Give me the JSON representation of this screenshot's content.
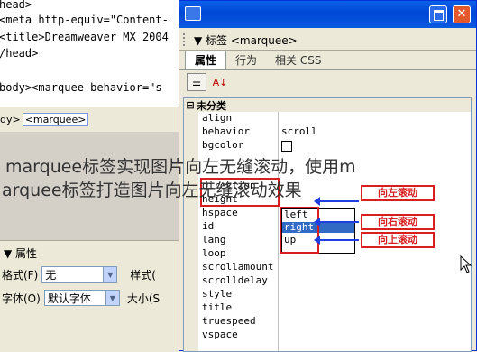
{
  "code": {
    "lines": [
      "head>",
      "<meta http-equiv=\"Content-",
      "<title>Dreamweaver MX 2004",
      "/head>",
      "",
      "body><marquee behavior=\"s"
    ]
  },
  "tag_selector": {
    "body_tag": "dy>",
    "marquee_tag": "<marquee>"
  },
  "left_props": {
    "title": "▼ 属性",
    "format_label": "格式(F)",
    "format_value": "无",
    "style_label": "样式(",
    "font_label": "字体(O)",
    "font_value": "默认字体",
    "size_label": "大小(S"
  },
  "panel": {
    "header": "▼ 标签 <marquee>",
    "tabs": [
      "属性",
      "行为",
      "相关 CSS"
    ],
    "active_tab": 0,
    "toolbar": {
      "list_icon": "list-icon",
      "sort_icon": "sort-az-icon"
    },
    "category": "未分类",
    "properties": [
      {
        "name": "align",
        "value": ""
      },
      {
        "name": "behavior",
        "value": "scroll"
      },
      {
        "name": "bgcolor",
        "value": ""
      },
      {
        "name": "direction",
        "value": ""
      },
      {
        "name": "height",
        "value": ""
      },
      {
        "name": "hspace",
        "value": ""
      },
      {
        "name": "id",
        "value": ""
      },
      {
        "name": "lang",
        "value": ""
      },
      {
        "name": "loop",
        "value": ""
      },
      {
        "name": "scrollamount",
        "value": ""
      },
      {
        "name": "scrolldelay",
        "value": ""
      },
      {
        "name": "style",
        "value": ""
      },
      {
        "name": "title",
        "value": ""
      },
      {
        "name": "truespeed",
        "value": ""
      },
      {
        "name": "vspace",
        "value": ""
      }
    ],
    "direction_options": [
      "left",
      "right",
      "up"
    ],
    "direction_selected": "right",
    "annotations": [
      "向左滚动",
      "向右滚动",
      "向上滚动"
    ]
  },
  "overlay": {
    "line1": "marquee标签实现图片向左无缝滚动，使用m",
    "line2": "arquee标签打造图片向左无缝滚动效果"
  },
  "colors": {
    "titlebar": "#0a5ae0",
    "annotation_red": "#d81e1e",
    "arrow_blue": "#1f3fe0",
    "selection": "#316ac5"
  }
}
